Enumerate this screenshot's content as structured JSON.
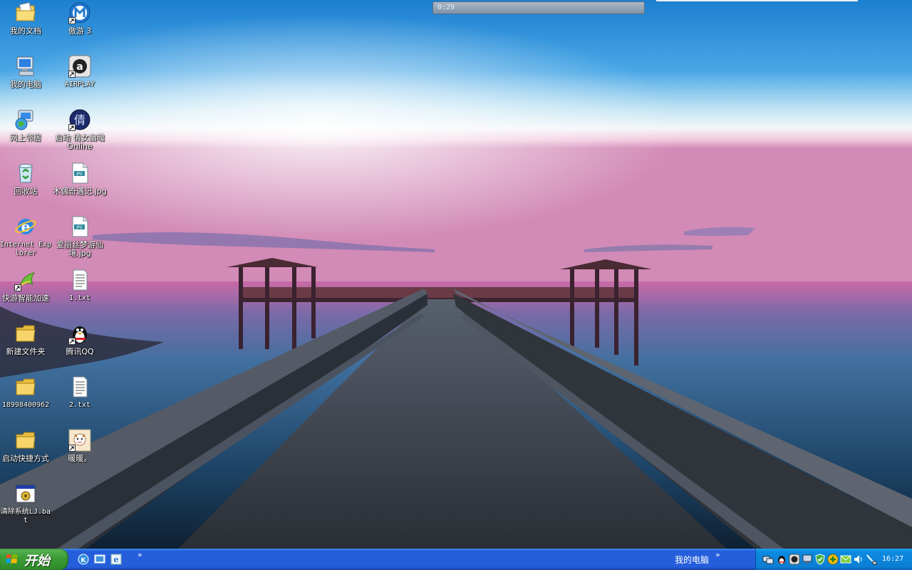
{
  "timer_widget": {
    "text": "0:29"
  },
  "desktop_icons": [
    {
      "id": "my-documents",
      "label": "我的文档"
    },
    {
      "id": "maxthon-3",
      "label": "傲游 3"
    },
    {
      "id": "my-computer",
      "label": "我的电脑"
    },
    {
      "id": "airplay",
      "label": "AIRPLAY"
    },
    {
      "id": "network",
      "label": "网上邻居"
    },
    {
      "id": "qiannv",
      "label": "启动 倩女幽魂Online"
    },
    {
      "id": "recycle-bin",
      "label": "回收站"
    },
    {
      "id": "mujiu-jpg",
      "label": "木偶奇遇记.jpg"
    },
    {
      "id": "ie",
      "label": "Internet Explorer"
    },
    {
      "id": "alice-jpg",
      "label": "爱丽丝梦游仙境.jpg"
    },
    {
      "id": "kuaiyou",
      "label": "快游智能加速"
    },
    {
      "id": "txt-1",
      "label": "1.txt"
    },
    {
      "id": "new-folder",
      "label": "新建文件夹"
    },
    {
      "id": "qq",
      "label": "腾讯QQ"
    },
    {
      "id": "folder-number",
      "label": "18998400962"
    },
    {
      "id": "txt-2",
      "label": "2.txt"
    },
    {
      "id": "shortcut-folder",
      "label": "启动快捷方式"
    },
    {
      "id": "nuannuan",
      "label": "暖暖。"
    },
    {
      "id": "clean-bat",
      "label": "清除系统LJ.bat"
    }
  ],
  "taskbar": {
    "start_label": "开始",
    "quicklaunch_chevron": "»",
    "active_task_label": "我的电脑",
    "task_chevron": "»",
    "clock": "16:27"
  },
  "colors": {
    "taskbar_blue": "#245edb",
    "start_green": "#3c9e37",
    "tray_blue": "#0b7fd4"
  }
}
